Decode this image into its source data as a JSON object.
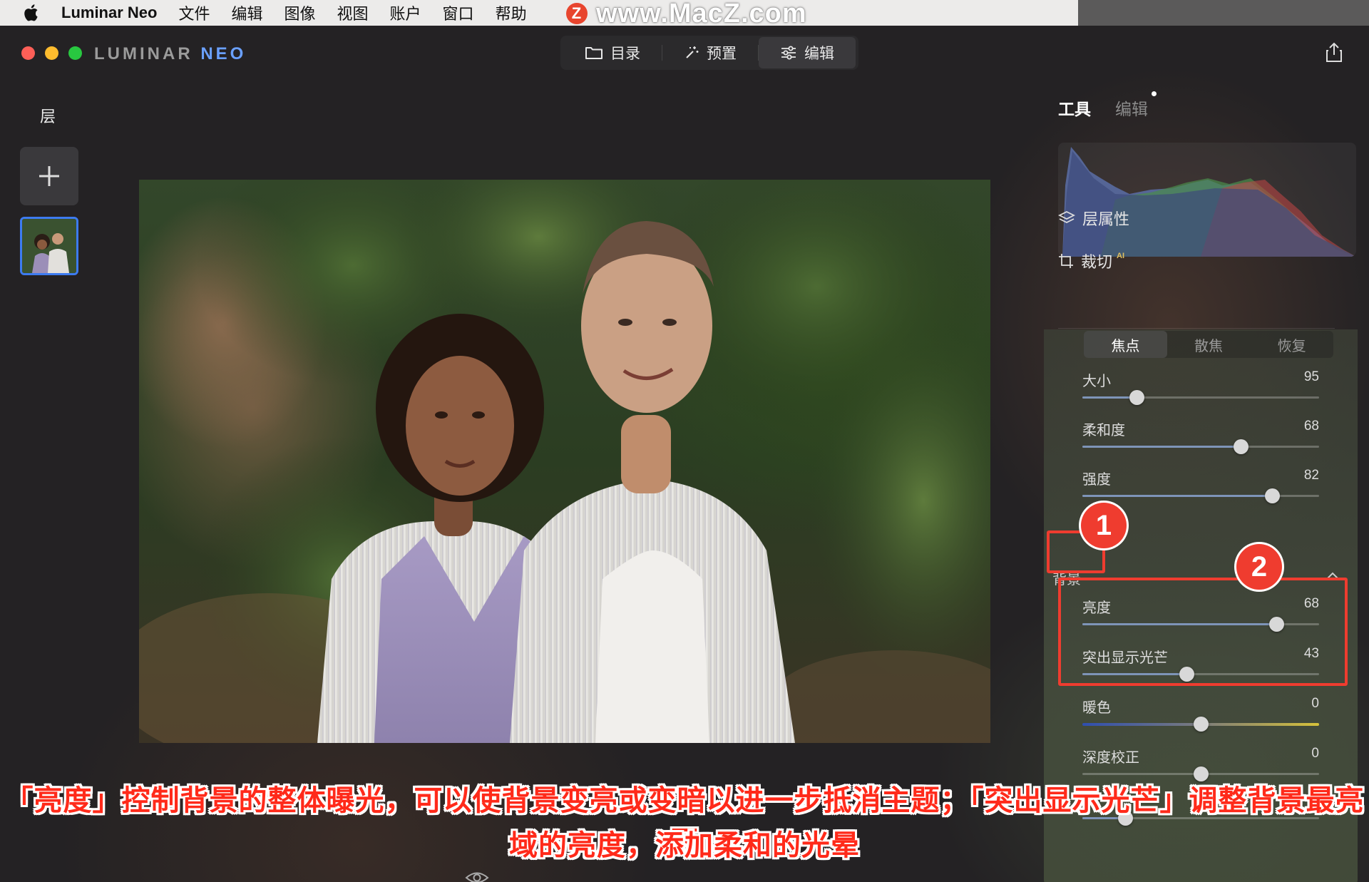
{
  "menubar": {
    "app_name": "Luminar Neo",
    "items": [
      "文件",
      "编辑",
      "图像",
      "视图",
      "账户",
      "窗口",
      "帮助"
    ]
  },
  "watermark": {
    "logo": "Z",
    "text": "www.MacZ.com"
  },
  "window": {
    "brand_left": "LUMINAR",
    "brand_right": "NEO",
    "nav": [
      {
        "label": "目录",
        "icon": "folder-icon"
      },
      {
        "label": "预置",
        "icon": "magic-wand-icon"
      },
      {
        "label": "编辑",
        "icon": "sliders-icon",
        "active": true
      }
    ]
  },
  "layers": {
    "title": "层"
  },
  "right_panel": {
    "tabs": [
      "工具",
      "编辑"
    ],
    "tools": [
      {
        "label": "层属性",
        "icon": "layers-icon"
      },
      {
        "label": "裁切",
        "icon": "crop-icon",
        "badge": "AI"
      }
    ],
    "segments": [
      "焦点",
      "散焦",
      "恢复"
    ],
    "focus_sliders": [
      {
        "label": "大小",
        "value": 95,
        "fraction": 0.23
      },
      {
        "label": "柔和度",
        "value": 68,
        "fraction": 0.67
      },
      {
        "label": "强度",
        "value": 82,
        "fraction": 0.8
      }
    ],
    "background_section": "背景",
    "background_sliders": [
      {
        "label": "亮度",
        "value": 68,
        "fraction": 0.82
      },
      {
        "label": "突出显示光芒",
        "value": 43,
        "fraction": 0.44
      },
      {
        "label": "暖色",
        "value": 0,
        "fraction": 0.5,
        "warm": true
      },
      {
        "label": "深度校正",
        "value": 0,
        "fraction": 0.5
      }
    ]
  },
  "annotations": {
    "badge1": "1",
    "badge2": "2",
    "caption_line1": "「亮度」控制背景的整体曝光，可以使背景变亮或变暗以进一步抵消主题；「突出显示光芒」调整背景最亮区",
    "caption_line2": "域的亮度，添加柔和的光晕"
  },
  "colors": {
    "accent": "#3d7bf0",
    "annotation_red": "#ef3c2f"
  }
}
